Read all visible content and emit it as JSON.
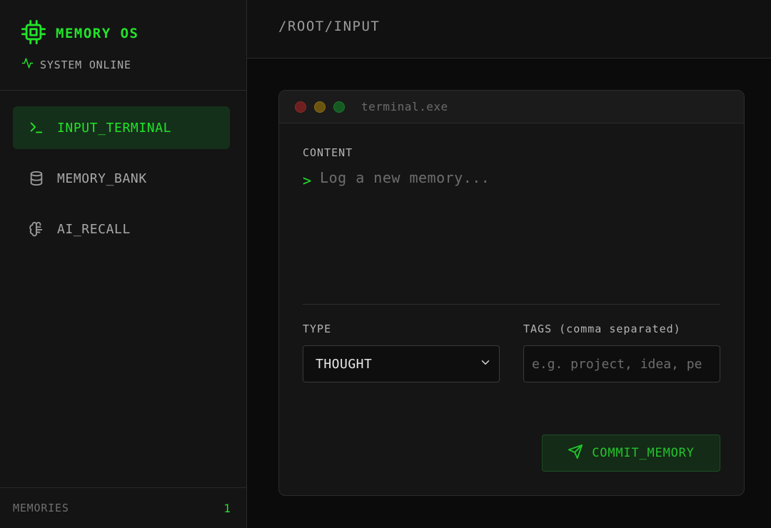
{
  "sidebar": {
    "brand": {
      "title": "MEMORY OS",
      "icon": "cpu-chip-icon"
    },
    "status": {
      "text": "SYSTEM ONLINE",
      "icon": "activity-icon"
    },
    "nav": [
      {
        "label": "INPUT_TERMINAL",
        "icon": "terminal-icon",
        "active": true
      },
      {
        "label": "MEMORY_BANK",
        "icon": "database-icon",
        "active": false
      },
      {
        "label": "AI_RECALL",
        "icon": "brain-icon",
        "active": false
      }
    ],
    "footer": {
      "label": "MEMORIES",
      "count": "1"
    }
  },
  "header": {
    "breadcrumb": "/ROOT/INPUT"
  },
  "terminal": {
    "window_title": "terminal.exe",
    "content": {
      "label": "CONTENT",
      "prompt": ">",
      "placeholder": "Log a new memory...",
      "value": ""
    },
    "type": {
      "label": "TYPE",
      "selected": "THOUGHT"
    },
    "tags": {
      "label": "TAGS (comma separated)",
      "placeholder": "e.g. project, idea, pe",
      "value": ""
    },
    "commit_label": "COMMIT_MEMORY"
  },
  "colors": {
    "accent": "#22e32a",
    "background": "#0b0b0b",
    "panel": "#141414",
    "active_nav_bg": "#15301a"
  }
}
